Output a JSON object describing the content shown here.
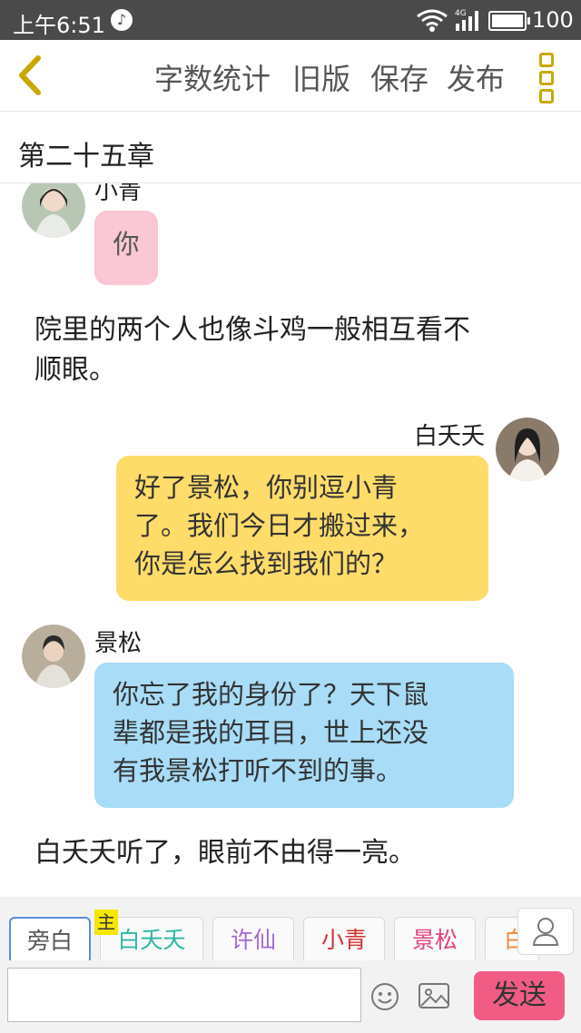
{
  "status_bar": {
    "time": "上午6:51",
    "network": "4G",
    "battery": "100"
  },
  "toolbar": {
    "word_count": "字数统计",
    "old_version": "旧版",
    "save": "保存",
    "publish": "发布"
  },
  "chapter": {
    "title": "第二十五章"
  },
  "messages": [
    {
      "type": "dialog",
      "speaker": "小青",
      "side": "left",
      "text": "你",
      "color": "#f9c8d4"
    },
    {
      "type": "narration",
      "text": "院里的两个人也像斗鸡一般相互看不顺眼。"
    },
    {
      "type": "dialog",
      "speaker": "白夭夭",
      "side": "right",
      "lines": [
        "好了景松，你别逗小青",
        "了。我们今日才搬过来，",
        "你是怎么找到我们的？"
      ],
      "color": "#fedc6a"
    },
    {
      "type": "dialog",
      "speaker": "景松",
      "side": "left",
      "lines": [
        "你忘了我的身份了？天下鼠",
        "辈都是我的耳目，世上还没",
        "有我景松打听不到的事。"
      ],
      "color": "#a8dcf7"
    },
    {
      "type": "narration",
      "text": "白夭夭听了，眼前不由得一亮。"
    }
  ],
  "narration_lines": {
    "first": [
      "院里的两个人也像斗鸡一般相互看不",
      "顺眼。"
    ]
  },
  "roles": [
    {
      "label": "旁白",
      "color": "#555555"
    },
    {
      "label": "白夭夭",
      "color": "#2bb8a6"
    },
    {
      "label": "许仙",
      "color": "#a368d6"
    },
    {
      "label": "小青",
      "color": "#d6302f"
    },
    {
      "label": "景松",
      "color": "#e0417f"
    },
    {
      "label": "白",
      "color": "#f08a3c"
    }
  ],
  "main_badge": "主",
  "input": {
    "placeholder": ""
  },
  "send_label": "发送",
  "colors": {
    "accent": "#c8a800",
    "send": "#f15c84"
  }
}
